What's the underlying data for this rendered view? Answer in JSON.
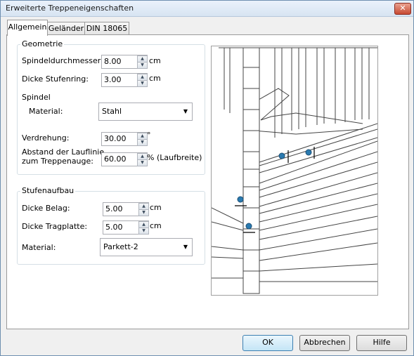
{
  "window": {
    "title": "Erweiterte Treppeneigenschaften",
    "close_label": "✕"
  },
  "tabs": [
    "Allgemein",
    "Geländer",
    "DIN 18065"
  ],
  "geometrie": {
    "legend": "Geometrie",
    "spindeldurchmesser": {
      "label": "Spindeldurchmesser:",
      "value": "8.00",
      "unit": "cm"
    },
    "dicke_stufenring": {
      "label": "Dicke Stufenring:",
      "value": "3.00",
      "unit": "cm"
    },
    "spindel_heading": "Spindel",
    "material": {
      "label": "Material:",
      "value": "Stahl"
    },
    "verdrehung": {
      "label": "Verdrehung:",
      "value": "30.00",
      "unit": "°"
    },
    "abstand": {
      "label_line1": "Abstand der Lauflinie",
      "label_line2": "zum Treppenauge:",
      "value": "60.00",
      "unit": "% (Laufbreite)"
    }
  },
  "stufenaufbau": {
    "legend": "Stufenaufbau",
    "dicke_belag": {
      "label": "Dicke Belag:",
      "value": "5.00",
      "unit": "cm"
    },
    "dicke_tragplatte": {
      "label": "Dicke Tragplatte:",
      "value": "5.00",
      "unit": "cm"
    },
    "material": {
      "label": "Material:",
      "value": "Parkett-2"
    }
  },
  "buttons": {
    "ok": "OK",
    "cancel": "Abbrechen",
    "help": "Hilfe"
  },
  "spin_up": "▲",
  "spin_down": "▼",
  "caret": "▼",
  "colors": {
    "marker": "#2a7ab0",
    "line": "#444444"
  }
}
